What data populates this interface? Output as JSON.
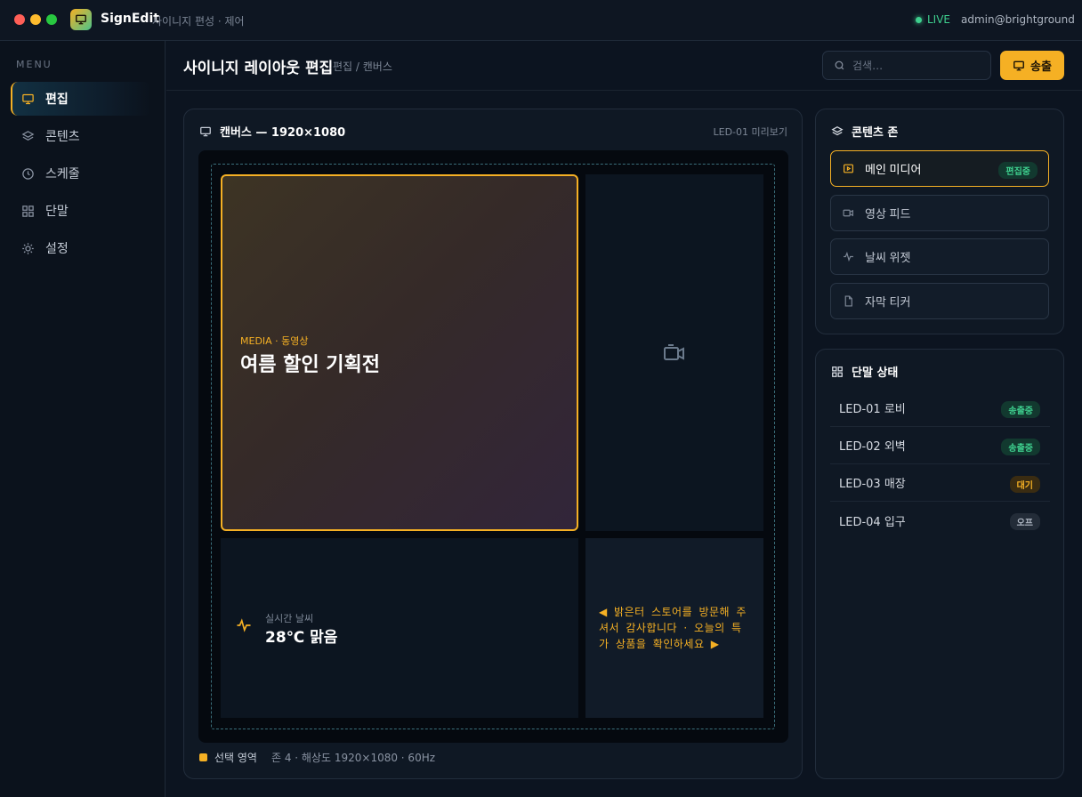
{
  "app": {
    "name": "SignEdit",
    "subtitle": "사이니지 편성 · 제어",
    "live": "LIVE",
    "user": "admin@brightground",
    "accent": "#f5b024",
    "live_color": "#3ecf8e"
  },
  "sidebar": {
    "section": "MENU",
    "items": [
      {
        "label": "편집",
        "icon": "monitor-icon",
        "active": true
      },
      {
        "label": "콘텐츠",
        "icon": "layers-icon",
        "active": false
      },
      {
        "label": "스케줄",
        "icon": "clock-icon",
        "active": false
      },
      {
        "label": "단말",
        "icon": "grid-icon",
        "active": false
      },
      {
        "label": "설정",
        "icon": "sun-icon",
        "active": false
      }
    ]
  },
  "header": {
    "title": "사이니지 레이아웃 편집",
    "breadcrumb": "편집 / 캔버스",
    "search_placeholder": "검색…",
    "broadcast_label": "송출"
  },
  "canvas": {
    "title": "캔버스 — 1920×1080",
    "preview": "LED-01 미리보기",
    "main_zone": {
      "tag": "MEDIA · 동영상",
      "headline": "여름 할인 기획전"
    },
    "weather_zone": {
      "label": "실시간 날씨",
      "value": "28℃ 맑음"
    },
    "ticker_zone": {
      "text": "◀ 밝은터 스토어를 방문해 주셔서 감사합니다 · 오늘의 특가 상품을 확인하세요 ▶"
    },
    "footer": {
      "selection": "선택 영역",
      "info": "존 4 · 해상도 1920×1080 · 60Hz"
    }
  },
  "content_zones": {
    "title": "콘텐츠 존",
    "items": [
      {
        "label": "메인 미디어",
        "icon": "play-icon",
        "badge": "편집중",
        "active": true
      },
      {
        "label": "영상 피드",
        "icon": "video-icon",
        "badge": "",
        "active": false
      },
      {
        "label": "날씨 위젯",
        "icon": "pulse-icon",
        "badge": "",
        "active": false
      },
      {
        "label": "자막 티커",
        "icon": "file-icon",
        "badge": "",
        "active": false
      }
    ]
  },
  "devices": {
    "title": "단말 상태",
    "items": [
      {
        "name": "LED-01 로비",
        "status": "송출중",
        "state": "on"
      },
      {
        "name": "LED-02 외벽",
        "status": "송출중",
        "state": "on"
      },
      {
        "name": "LED-03 매장",
        "status": "대기",
        "state": "wait"
      },
      {
        "name": "LED-04 입구",
        "status": "오프",
        "state": "off"
      }
    ]
  }
}
